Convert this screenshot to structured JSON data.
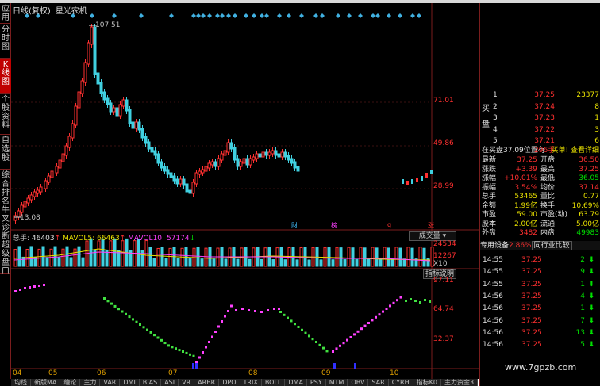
{
  "window": {
    "title": "日线(复权)",
    "stock_name": "星光农机"
  },
  "sidebar": {
    "tabs": [
      {
        "label": "应用",
        "active": false
      },
      {
        "label": "分时图",
        "active": false
      },
      {
        "label": "K线图",
        "active": true
      },
      {
        "label": "个股资料",
        "active": false
      },
      {
        "label": "自选股",
        "active": false
      },
      {
        "label": "综合排名",
        "active": false
      },
      {
        "label": "牛叉诊断",
        "active": false
      },
      {
        "label": "超级盘口",
        "active": false
      }
    ]
  },
  "main": {
    "price_axis": [
      "71.01",
      "49.86",
      "28.99"
    ],
    "price_high_label": "107.51",
    "price_low_label": "13.08",
    "event_markers": [
      {
        "text": "财",
        "color": "#40c0ff"
      },
      {
        "text": "榜",
        "color": "#ff40ff"
      },
      {
        "text": "q",
        "color": "#ff3030"
      },
      {
        "text": "涨",
        "color": "#ff3030"
      }
    ],
    "volume": {
      "label": "总手",
      "value": "46403",
      "ma5_label": "MAVOL5",
      "ma5": "66463",
      "ma10_label": "MAVOL10",
      "ma10": "57174",
      "button": "成交量",
      "axis": [
        "24534",
        "12267",
        "X10"
      ]
    },
    "indicator": {
      "button": "指标说明",
      "axis": [
        "97.11",
        "64.74",
        "32.37"
      ]
    },
    "dates": [
      "04",
      "05",
      "06",
      "07",
      "08",
      "09",
      "10"
    ],
    "bottom_tabs": [
      "均线",
      "新版MA",
      "缠论",
      "主力",
      "VAR",
      "DMI",
      "BIAS",
      "ASI",
      "VR",
      "ARBR",
      "DPO",
      "TRIX",
      "BOLL",
      "DMA",
      "PSY",
      "MTM",
      "OBV",
      "SAR",
      "CYRH",
      "指标K0",
      "主力资金3",
      "CHAOP"
    ],
    "bottom_tab_active": "CHAOP"
  },
  "right_panel": {
    "bids": [
      {
        "level": "1",
        "price": "37.25",
        "vol": "23377"
      },
      {
        "level": "2",
        "price": "37.24",
        "vol": "8"
      },
      {
        "level": "3",
        "price": "37.23",
        "vol": "1"
      },
      {
        "level": "4",
        "price": "37.22",
        "vol": "3"
      },
      {
        "level": "5",
        "price": "37.21",
        "vol": "6"
      }
    ],
    "bid_side_label": "买盘",
    "notice": "在买盘37.09位置有",
    "notice_qty": "296手",
    "notice_action": "买单! 查看详细",
    "stats": [
      {
        "k1": "最新",
        "v1": "37.25",
        "k2": "开盘",
        "v2": "36.50"
      },
      {
        "k1": "涨跌",
        "v1": "+3.39",
        "k2": "最高",
        "v2": "37.25"
      },
      {
        "k1": "涨幅",
        "v1": "+10.01%",
        "k2": "最低",
        "v2": "36.05"
      },
      {
        "k1": "振幅",
        "v1": "3.54%",
        "k2": "均价",
        "v2": "37.14"
      },
      {
        "k1": "总手",
        "v1": "53465",
        "k2": "量比",
        "v2": "0.77"
      },
      {
        "k1": "金额",
        "v1": "1.99亿",
        "k2": "换手",
        "v2": "10.69%"
      },
      {
        "k1": "市盈",
        "v1": "59.00",
        "k2": "市盈(动)",
        "v2": "63.79"
      },
      {
        "k1": "股本",
        "v1": "2.00亿",
        "k2": "流通",
        "v2": "5.00亿"
      },
      {
        "k1": "外盘",
        "v1": "3482",
        "k2": "内盘",
        "v2": "49983"
      }
    ],
    "bar_left": "专用设备",
    "bar_pct": "2.86%",
    "bar_button": "同行业比较",
    "ticks": [
      {
        "time": "14:55",
        "price": "37.25",
        "vol": "2"
      },
      {
        "time": "14:55",
        "price": "37.25",
        "vol": "9"
      },
      {
        "time": "14:55",
        "price": "37.25",
        "vol": "1"
      },
      {
        "time": "14:56",
        "price": "37.25",
        "vol": "4"
      },
      {
        "time": "14:56",
        "price": "37.25",
        "vol": "1"
      },
      {
        "time": "14:56",
        "price": "37.25",
        "vol": "7"
      },
      {
        "time": "14:56",
        "price": "37.25",
        "vol": "13"
      },
      {
        "time": "14:56",
        "price": "37.25",
        "vol": "5"
      }
    ]
  },
  "watermark": "www.7gpzb.com"
}
